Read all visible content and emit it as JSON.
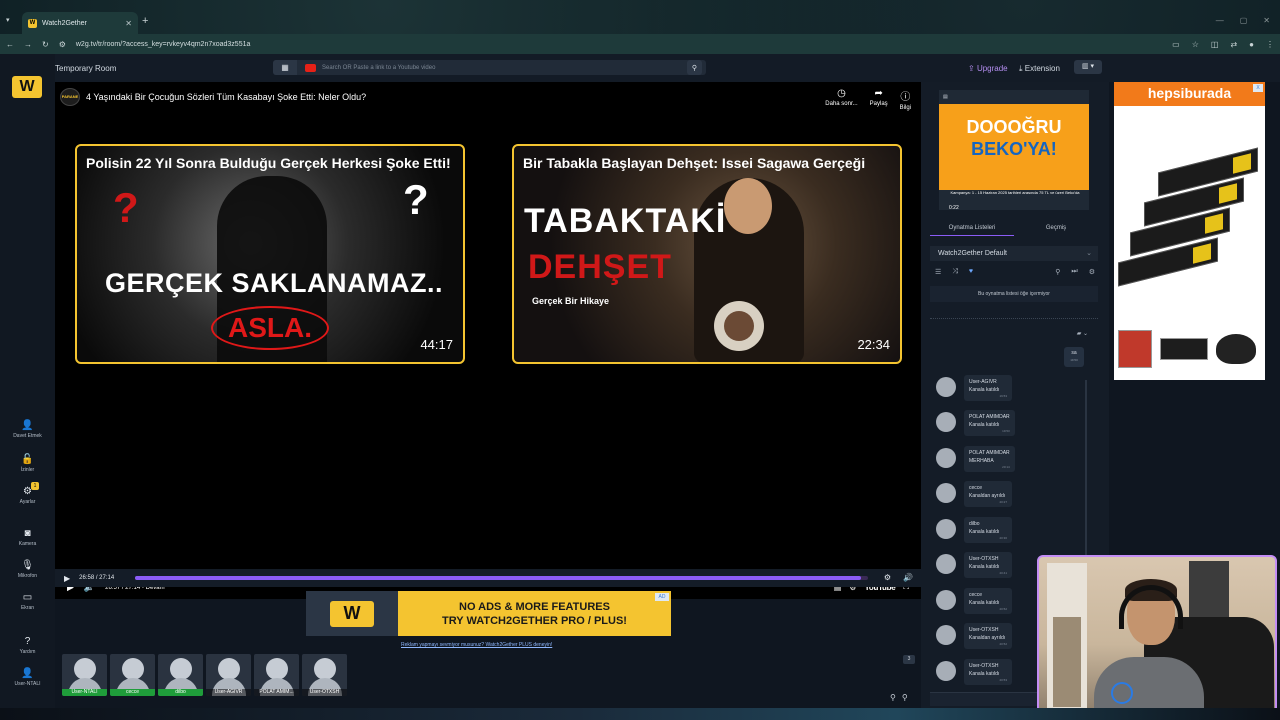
{
  "browser": {
    "tab_title": "Watch2Gether",
    "url": "w2g.tv/tr/room/?access_key=rvkeyv4qm2n7xoad3z551a"
  },
  "topbar": {
    "room_name": "Temporary Room",
    "search_placeholder": "Search OR Paste a link to a Youtube video",
    "upgrade": "Upgrade",
    "extension": "Extension"
  },
  "leftnav": {
    "logo": "W",
    "items": [
      {
        "label": "Davet Etmek",
        "icon": "add-user-icon"
      },
      {
        "label": "İzinler",
        "icon": "lock-icon"
      },
      {
        "label": "Ayarlar",
        "icon": "gear-icon",
        "badge": "1"
      },
      {
        "label": "Kamera",
        "icon": "camera-icon"
      },
      {
        "label": "Mikrofon",
        "icon": "microphone-icon"
      },
      {
        "label": "Ekran",
        "icon": "screen-icon"
      },
      {
        "label": "Yardım",
        "icon": "help-icon"
      },
      {
        "label": "User-NTALI",
        "icon": "user-icon"
      }
    ]
  },
  "video": {
    "channel_logo": "PARANE",
    "title": "4 Yaşındaki Bir Çocuğun Sözleri Tüm Kasabayı Şoke Etti: Neler Oldu?",
    "actions": [
      "Daha sonr...",
      "Paylaş",
      "Bilgi"
    ],
    "cards": [
      {
        "title": "Polisin 22 Yıl Sonra Bulduğu Gerçek Herkesi Şoke Etti!",
        "big_text": "GERÇEK SAKLANAMAZ..",
        "stamp": "ASLA.",
        "duration": "44:17"
      },
      {
        "title": "Bir Tabakla Başlayan Dehşet: Issei Sagawa Gerçeği",
        "big_text_1": "TABAKTAKİ",
        "big_text_2": "DEHŞET",
        "subtitle": "Gerçek Bir Hikaye",
        "duration": "22:34"
      }
    ],
    "yt_time": "26:57 / 27:14 • Devam",
    "yt_brand": "YouTube",
    "w2g_time": "26:58 / 27:14",
    "progress": 0.99
  },
  "ad": {
    "text_line1": "NO ADS & MORE FEATURES",
    "text_line2": "TRY WATCH2GETHER PRO / PLUS!",
    "logo": "W",
    "badge": "AD",
    "link": "Reklam yapmayı sevmiyor musunuz? Watch2Gether PLUS deneyin!"
  },
  "users": [
    {
      "name": "User-NTALI",
      "green": true
    },
    {
      "name": "cecce",
      "green": true
    },
    {
      "name": "dilbo",
      "green": true
    },
    {
      "name": "User-AGIVR",
      "green": false
    },
    {
      "name": "POLAT AMIM...",
      "green": false
    },
    {
      "name": "User-OTXSH",
      "green": false
    }
  ],
  "participant_count": "3",
  "rightpanel": {
    "small_ad": {
      "line1": "DOOOĞRU",
      "line2": "BEKO'YA!",
      "fine": "Kampanya: 1 - 15 Haziran 2025 tarihleri arasında 75 TL ve üzeri Beko'da",
      "time": "0:22"
    },
    "tabs": [
      "Oynatma Listeleri",
      "Geçmiş"
    ],
    "playlist": "Watch2Gether Default",
    "playlist_empty": "Bu oynatma listesi öğe içermiyor",
    "my_msg": {
      "text": "sa",
      "time": "19:50"
    },
    "messages": [
      {
        "user": "User-AGIVR",
        "text": "Kanala katıldı",
        "time": "19:53"
      },
      {
        "user": "POLAT AMIMDAR",
        "text": "Kanala katıldı",
        "time": "19:53"
      },
      {
        "user": "POLAT AMIMDAR",
        "text": "MERHABA",
        "time": "20:14"
      },
      {
        "user": "cecce",
        "text": "Kanaldan ayrıldı",
        "time": "20:27"
      },
      {
        "user": "dilbo",
        "text": "Kanala katıldı",
        "time": "20:30"
      },
      {
        "user": "User-OTXSH",
        "text": "Kanala katıldı",
        "time": "20:41"
      },
      {
        "user": "cecce",
        "text": "Kanala katıldı",
        "time": "20:52"
      },
      {
        "user": "User-OTXSH",
        "text": "Kanaldan ayrıldı",
        "time": "20:52"
      },
      {
        "user": "User-OTXSH",
        "text": "Kanala katıldı",
        "time": "20:53"
      }
    ]
  },
  "big_ad": {
    "brand": "hepsiburada",
    "close": "X"
  }
}
